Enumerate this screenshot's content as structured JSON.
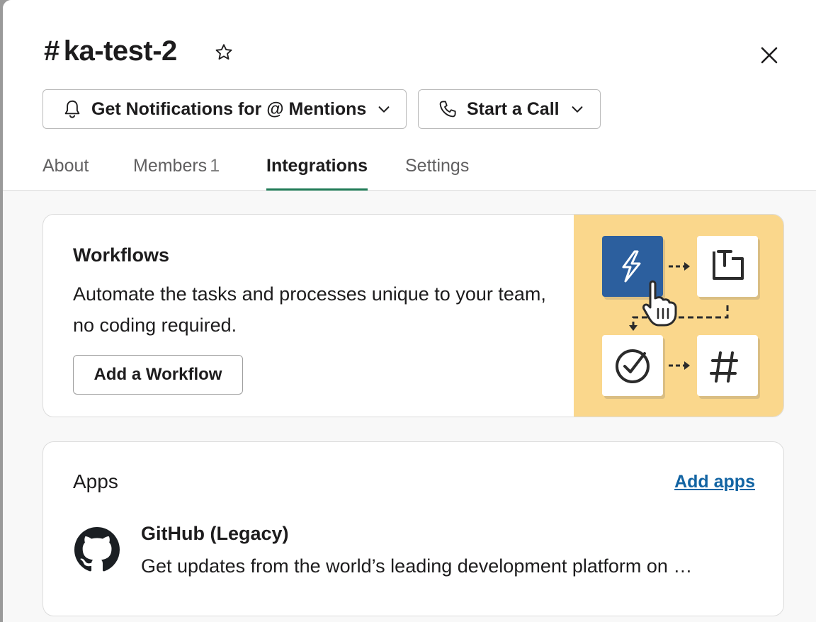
{
  "channel": {
    "hash": "#",
    "name": "ka-test-2"
  },
  "buttons": {
    "notifications_label": "Get Notifications for @ Mentions",
    "call_label": "Start a Call"
  },
  "tabs": [
    {
      "label": "About",
      "count": ""
    },
    {
      "label": "Members",
      "count": "1"
    },
    {
      "label": "Integrations",
      "count": "",
      "active": true
    },
    {
      "label": "Settings",
      "count": ""
    }
  ],
  "workflows": {
    "title": "Workflows",
    "description": "Automate the tasks and processes unique to your team, no coding required.",
    "button_label": "Add a Workflow"
  },
  "apps": {
    "title": "Apps",
    "add_label": "Add apps",
    "items": [
      {
        "name": "GitHub (Legacy)",
        "description": "Get updates from the world’s leading development platform on …",
        "icon": "github-icon"
      }
    ]
  },
  "colors": {
    "active_tab_underline": "#1f7a56",
    "link": "#1264a3",
    "illustration_bg": "#fad78c",
    "workflow_tile": "#2c5f9e"
  }
}
